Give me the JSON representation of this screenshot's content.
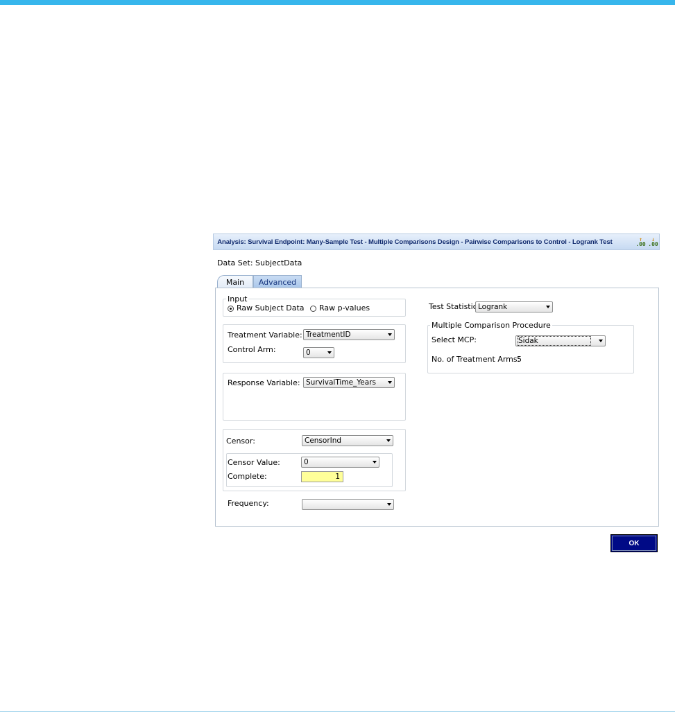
{
  "window": {
    "title": "Analysis: Survival Endpoint: Many-Sample Test - Multiple Comparisons Design - Pairwise Comparisons to Control - Logrank Test",
    "icon1_text": ".00",
    "icon2_text": ".00"
  },
  "dataset": {
    "label": "Data Set: SubjectData"
  },
  "tabs": [
    {
      "label": "Main",
      "active": true
    },
    {
      "label": "Advanced",
      "active": false
    }
  ],
  "input": {
    "legend": "Input",
    "options": [
      {
        "label": "Raw Subject Data",
        "selected": true
      },
      {
        "label": "Raw p-values",
        "selected": false
      }
    ]
  },
  "treatment": {
    "variable_label": "Treatment Variable:",
    "variable_value": "TreatmentID",
    "control_label": "Control Arm:",
    "control_value": "0"
  },
  "response": {
    "label": "Response Variable:",
    "value": "SurvivalTime_Years"
  },
  "censor": {
    "label": "Censor:",
    "value": "CensorInd",
    "censor_value_label": "Censor Value:",
    "censor_value": "0",
    "complete_label": "Complete:",
    "complete_value": "1"
  },
  "frequency": {
    "label": "Frequency:",
    "value": ""
  },
  "test_statistic": {
    "label": "Test Statistic:",
    "value": "Logrank"
  },
  "mcp": {
    "legend": "Multiple Comparison Procedure",
    "select_label": "Select MCP:",
    "select_value": "Sidak",
    "arms_label": "No. of Treatment Arms:",
    "arms_value": "5"
  },
  "ok_button": {
    "label": "OK"
  },
  "colors": {
    "top_bar": "#37b6ec",
    "title_text": "#102a6e",
    "ok_button_bg": "#000a86",
    "complete_field_bg": "#ffff99"
  }
}
